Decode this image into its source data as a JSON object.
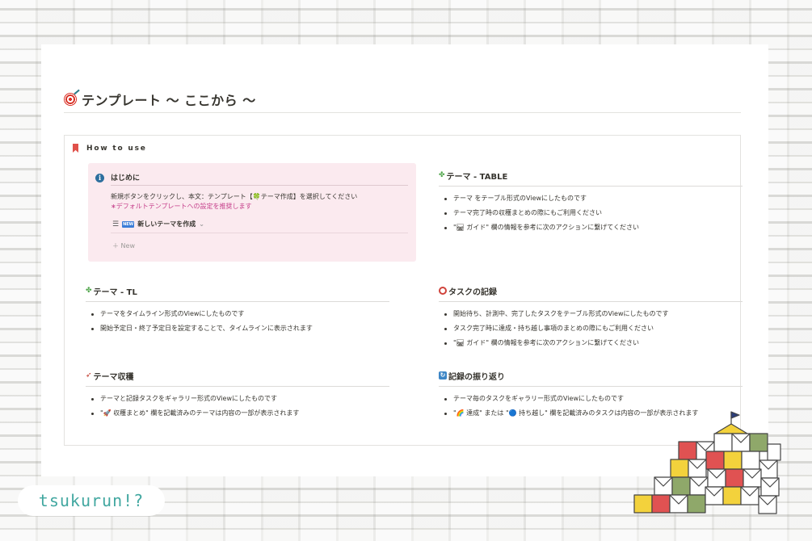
{
  "page": {
    "title": "テンプレート 〜 ここから 〜",
    "title_icon": "target-icon"
  },
  "howto": {
    "label": "How to use",
    "icon": "bookmark-icon"
  },
  "callout": {
    "icon": "info-icon",
    "icon_text": "i",
    "title": "はじめに",
    "line1": "新規ボタンをクリックし、本文：テンプレート【🍀テーマ作成】を選択してください",
    "line2": "∗デフォルトテンプレートへの設定を推奨します",
    "button_badge": "NEW",
    "button_label": "新しいテーマを作成",
    "new_label": "New"
  },
  "sections": {
    "table": {
      "title": "テーマ - TABLE",
      "items": [
        "テーマ をテーブル形式のViewにしたものです",
        "テーマ完了時の収穫まとめの際にもご利用ください",
        "\"🛤 ガイド\" 欄の情報を参考に次のアクションに繋げてください"
      ]
    },
    "tl": {
      "title": "テーマ - TL",
      "items": [
        "テーマをタイムライン形式のViewにしたものです",
        "開始予定日・終了予定日を設定することで、タイムラインに表示されます"
      ]
    },
    "task": {
      "title": "タスクの記録",
      "items": [
        "開始待ち、計測中、完了したタスクをテーブル形式のViewにしたものです",
        "タスク完了時に達成・持ち越し事項のまとめの際にもご利用ください",
        "\"🛤 ガイド\" 欄の情報を参考に次のアクションに繋げてください"
      ]
    },
    "harvest": {
      "title": "テーマ収穫",
      "items": [
        "テーマと記録タスクをギャラリー形式のViewにしたものです",
        "\"🚀 収穫まとめ\" 欄を記載済みのテーマは内容の一部が表示されます"
      ]
    },
    "review": {
      "title": "記録の振り返り",
      "items": [
        "テーマ毎のタスクをギャラリー形式のViewにしたものです",
        "\"🌈 達成\" または \"🔵 持ち越し\" 欄を記載済みのタスクは内容の一部が表示されます"
      ]
    }
  },
  "brand": {
    "logo_text": "tsukurun!?"
  },
  "colors": {
    "callout_bg": "#fbeaef",
    "callout_accent": "#c53e8a",
    "brand_teal": "#41a7a0"
  }
}
